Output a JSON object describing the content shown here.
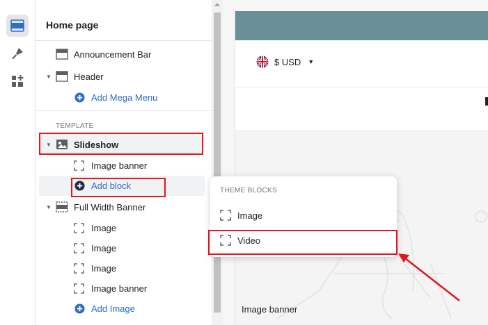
{
  "rail": {
    "items": [
      {
        "name": "sections",
        "icon": "layout-sections-icon",
        "active": true
      },
      {
        "name": "theme-settings",
        "icon": "paintbrush-icon",
        "active": false
      },
      {
        "name": "app-blocks",
        "icon": "apps-add-icon",
        "active": false
      }
    ]
  },
  "panel": {
    "title": "Home page",
    "header_group": {
      "announcement_bar": "Announcement Bar",
      "header": "Header",
      "add_mega_menu": "Add Mega Menu"
    },
    "template_label": "TEMPLATE",
    "slideshow": {
      "label": "Slideshow",
      "image_banner": "Image banner",
      "add_block": "Add block"
    },
    "full_width_banner": {
      "label": "Full Width Banner",
      "blocks": [
        "Image",
        "Image",
        "Image",
        "Image banner"
      ],
      "add_image": "Add Image"
    }
  },
  "popup": {
    "title": "THEME BLOCKS",
    "items": [
      "Image",
      "Video"
    ]
  },
  "preview": {
    "currency": "$ USD",
    "hero_caption": "Image banner",
    "announcement_color": "#6b8f96"
  },
  "colors": {
    "link": "#2c6ecb",
    "highlight": "#e2141d"
  }
}
